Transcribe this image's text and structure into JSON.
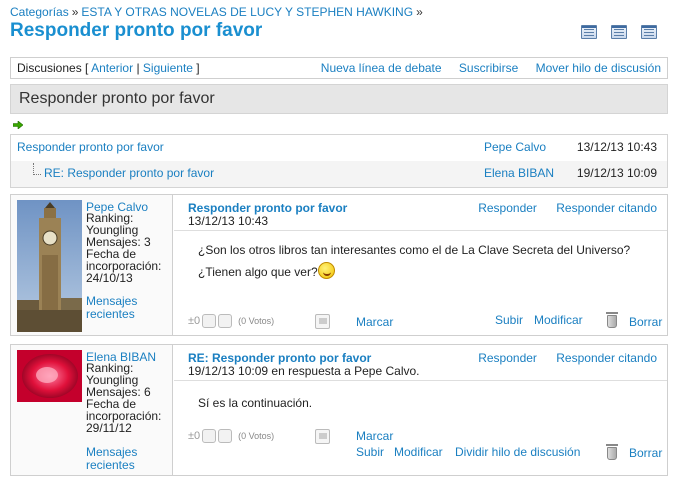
{
  "breadcrumb": {
    "items": [
      "Categorías",
      "ESTA Y OTRAS NOVELAS DE LUCY Y STEPHEN HAWKING"
    ],
    "separator": "»"
  },
  "page_title": "Responder pronto por favor",
  "view_icons": [
    "list-view-icon",
    "threaded-view-icon",
    "flat-view-icon"
  ],
  "nav": {
    "label": "Discusiones",
    "open_bracket": "[",
    "close_bracket": "]",
    "separator": "|",
    "prev": "Anterior",
    "next": "Siguiente",
    "new_thread": "Nueva línea de debate",
    "subscribe": "Suscribirse",
    "move_thread": "Mover hilo de discusión"
  },
  "thread_title": "Responder pronto por favor",
  "tree": [
    {
      "subject": "Responder pronto por favor",
      "author": "Pepe Calvo",
      "date": "13/12/13 10:43"
    },
    {
      "subject": "RE: Responder pronto por favor",
      "author": "Elena BIBAN",
      "date": "19/12/13 10:09"
    }
  ],
  "posts": [
    {
      "user": {
        "name": "Pepe Calvo",
        "stats": "Ranking:\nYoungling\nMensajes: 3\nFecha de\nincorporación:\n24/10/13",
        "recent": "Mensajes recientes"
      },
      "title": "Responder pronto por favor",
      "date": "13/12/13 10:43",
      "reply": "Responder",
      "reply_quote": "Responder citando",
      "text_line1": "¿Son los otros libros tan interesantes como el de La Clave Secreta del Universo?",
      "text_line2": "¿Tienen algo que ver?",
      "votes": "±0",
      "votes_count": "(0 Votos)",
      "flag": "Marcar",
      "up": "Subir",
      "edit": "Modificar",
      "delete": "Borrar"
    },
    {
      "user": {
        "name": "Elena BIBAN",
        "stats": "Ranking:\nYoungling\nMensajes: 6\nFecha de\nincorporación:\n29/11/12",
        "recent": "Mensajes recientes"
      },
      "title": "RE: Responder pronto por favor",
      "date": "19/12/13 10:09 en respuesta a Pepe Calvo.",
      "reply": "Responder",
      "reply_quote": "Responder citando",
      "text_line1": "Sí es la continuación.",
      "votes": "±0",
      "votes_count": "(0 Votos)",
      "flag": "Marcar",
      "up": "Subir",
      "edit": "Modificar",
      "split": "Dividir hilo de discusión",
      "delete": "Borrar"
    }
  ]
}
